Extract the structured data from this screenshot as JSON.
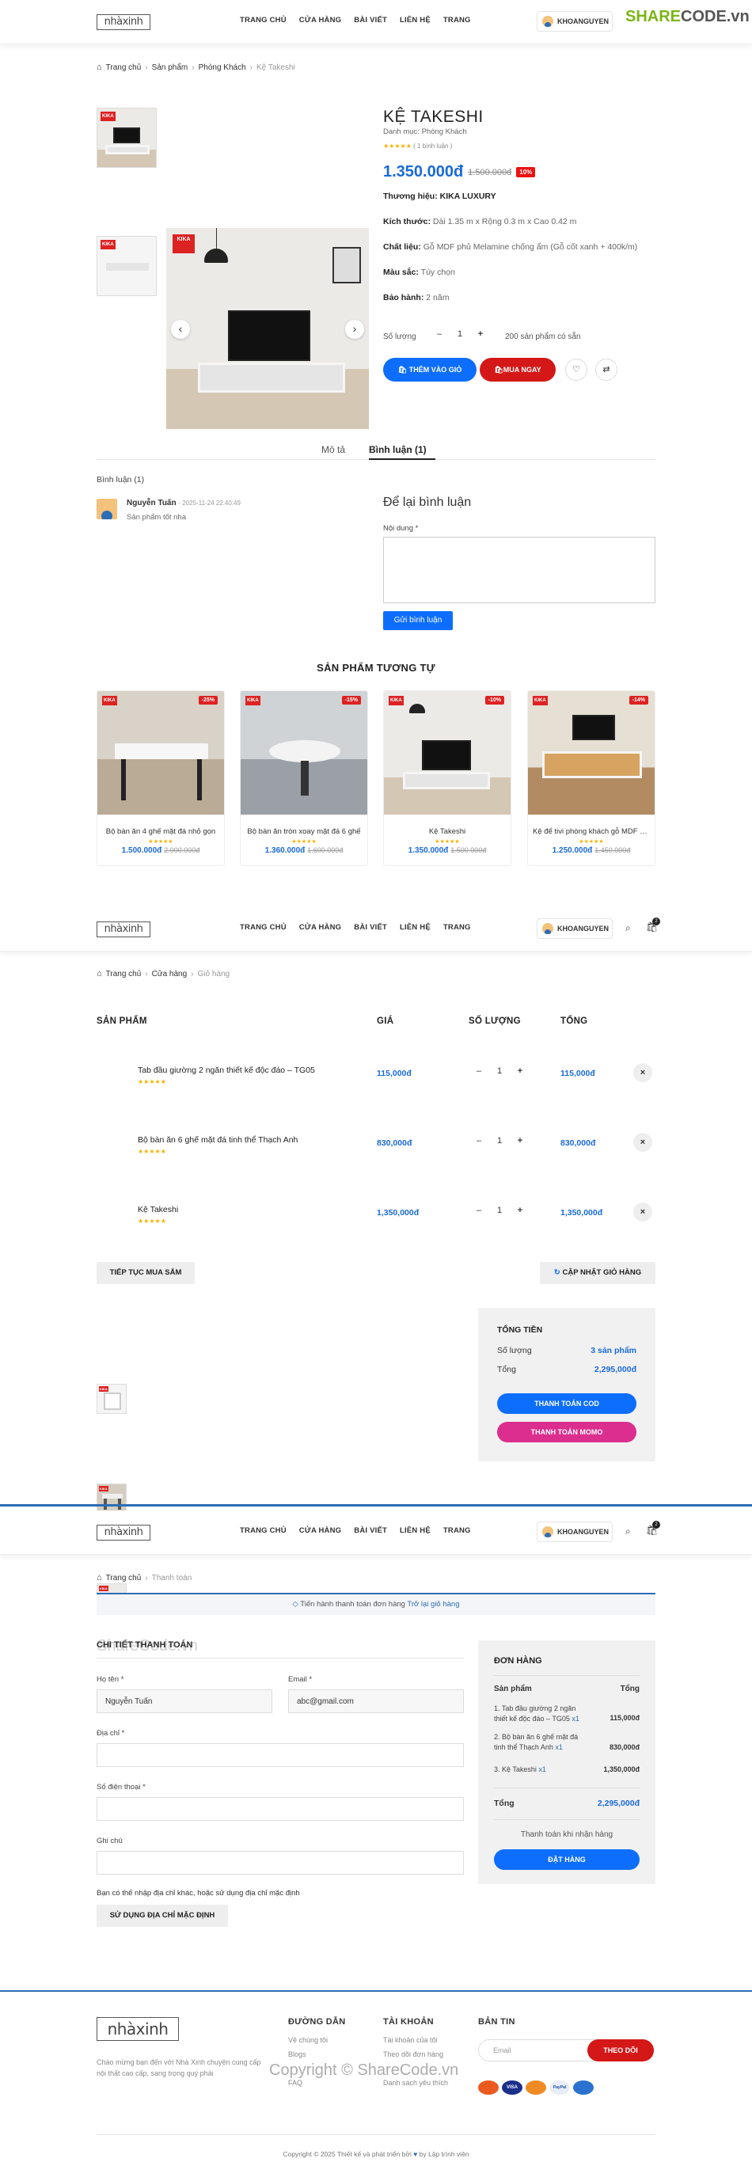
{
  "header": {
    "logo": "nhàxinh",
    "nav": [
      "TRANG CHỦ",
      "CỬA HÀNG",
      "BÀI VIẾT",
      "LIÊN HỆ",
      "TRANG"
    ],
    "user": "KHOANGUYEN",
    "cart_count": "2",
    "sharecode_share": "SHARE",
    "sharecode_code": "CODE.vn"
  },
  "product": {
    "breadcrumb": [
      "Trang chủ",
      "Sản phẩm",
      "Phòng Khách",
      "Kệ Takeshi"
    ],
    "brand_badge": "KIKA",
    "title": "KỆ TAKESHI",
    "category": "Danh mục: Phòng Khách",
    "reviews": "( 1 bình luận )",
    "price": "1.350.000đ",
    "old_price": "1.500.000đ",
    "discount": "10%",
    "specs": [
      {
        "label": "Thương hiệu:",
        "value": "KIKA LUXURY",
        "bold": true
      },
      {
        "label": "Kích thước:",
        "value": "Dài 1.35 m x Rộng 0.3 m x Cao 0.42 m"
      },
      {
        "label": "Chất liệu:",
        "value": "Gỗ MDF phủ Melamine chống ẩm (Gỗ cốt xanh + 400k/m)"
      },
      {
        "label": "Màu sắc:",
        "value": "Tùy chọn"
      },
      {
        "label": "Bảo hành:",
        "value": "2 năm"
      }
    ],
    "qty_label": "Số lượng",
    "qty": "1",
    "stock": "200 sản phẩm có sẵn",
    "add_cart": "THÊM VÀO GIỎ",
    "buy_now": "MUA NGAY",
    "tabs": [
      "Mô tả",
      "Bình luận (1)"
    ],
    "comments_title": "Bình luận (1)",
    "comment": {
      "author": "Nguyễn Tuấn",
      "date": "- 2025-11-24 22:40:49",
      "text": "Sản phẩm tốt nha"
    },
    "form_title": "Để lại bình luận",
    "form_label": "Nội dung *",
    "submit": "Gửi bình luận"
  },
  "related": {
    "title": "SẢN PHẨM TƯƠNG TỰ",
    "items": [
      {
        "name": "Bộ bàn ăn 4 ghế mặt đá nhỏ gọn",
        "price": "1.500.000đ",
        "old": "2.000.000đ",
        "disc": "-25%"
      },
      {
        "name": "Bộ bàn ăn tròn xoay mặt đá 6 ghế",
        "price": "1.360.000đ",
        "old": "1.600.000đ",
        "disc": "-15%"
      },
      {
        "name": "Kệ Takeshi",
        "price": "1.350.000đ",
        "old": "1.500.000đ",
        "disc": "-10%"
      },
      {
        "name": "Kệ để tivi phòng khách gỗ MDF kiể...",
        "price": "1.250.000đ",
        "old": "1.450.000đ",
        "disc": "-14%"
      }
    ]
  },
  "cart": {
    "breadcrumb": [
      "Trang chủ",
      "Cửa hàng",
      "Giỏ hàng"
    ],
    "headers": [
      "SẢN PHẨM",
      "GIÁ",
      "SỐ LƯỢNG",
      "TỔNG"
    ],
    "rows": [
      {
        "name": "Tab đầu giường 2 ngăn thiết kế độc đáo – TG05",
        "price": "115,000đ",
        "qty": "1",
        "total": "115,000đ"
      },
      {
        "name": "Bộ bàn ăn 6 ghế mặt đá tinh thể Thạch Anh",
        "price": "830,000đ",
        "qty": "1",
        "total": "830,000đ"
      },
      {
        "name": "Kệ Takeshi",
        "price": "1,350,000đ",
        "qty": "1",
        "total": "1,350,000đ"
      }
    ],
    "continue": "TIẾP TỤC MUA SẮM",
    "update": "CẬP NHẬT GIỎ HÀNG",
    "summary_title": "TỔNG TIỀN",
    "qty_label": "Số lượng",
    "qty_value": "3 sản phẩm",
    "total_label": "Tổng",
    "total_value": "2,295,000đ",
    "cod": "THANH TOÁN COD",
    "momo": "THANH TOÁN MOMO"
  },
  "checkout": {
    "breadcrumb": [
      "Trang chủ",
      "Thanh toán"
    ],
    "notice": "Tiến hành thanh toán đơn hàng",
    "notice_link": "Trở lại giỏ hàng",
    "title": "CHI TIẾT THANH TOÁN",
    "watermark": "ShareCode.vn",
    "name_label": "Họ tên *",
    "name_value": "Nguyễn Tuấn",
    "email_label": "Email *",
    "email_value": "abc@gmail.com",
    "address_label": "Địa chỉ *",
    "phone_label": "Số điện thoại *",
    "note_label": "Ghi chú",
    "address_question": "Bạn có thể nhập địa chỉ khác, hoặc sử dụng địa chỉ mặc định",
    "default_address": "SỬ DỤNG ĐỊA CHỈ MẶC ĐỊNH",
    "order_title": "ĐƠN HÀNG",
    "col_product": "Sản phẩm",
    "col_total": "Tổng",
    "items": [
      {
        "name": "1. Tab đầu giường 2 ngăn thiết kế độc đáo – TG05",
        "qty": "x1",
        "total": "115,000đ"
      },
      {
        "name": "2. Bộ bàn ăn 6 ghế mặt đá tinh thể Thạch Anh",
        "qty": "x1",
        "total": "830,000đ"
      },
      {
        "name": "3. Kệ Takeshi",
        "qty": "x1",
        "total": "1,350,000đ"
      }
    ],
    "total_label": "Tổng",
    "total_value": "2,295,000đ",
    "payment": "Thanh toán khi nhận hàng",
    "place_order": "ĐẶT HÀNG"
  },
  "footer": {
    "desc": "Chào mừng bạn đến với Nhà Xinh chuyên cung cấp nội thất cao cấp, sang trọng quý phái",
    "col1_title": "ĐƯỜNG DẪN",
    "col1": [
      "Về chúng tôi",
      "Blogs",
      "FAQ"
    ],
    "col2_title": "TÀI KHOẢN",
    "col2": [
      "Tài khoản của tôi",
      "Theo dõi đơn hàng",
      "Danh sách yêu thích"
    ],
    "col3_title": "BẢN TIN",
    "email_placeholder": "Email",
    "subscribe": "THEO DÕI",
    "payments": [
      "MasterCard",
      "VISA",
      "Discover",
      "PayPal",
      "Amex"
    ],
    "copyright": "Copyright © 2025 Thiết kế và phát triển bởi",
    "copyright_by": "by Lập trình viên",
    "watermark": "Copyright © ShareCode.vn"
  }
}
